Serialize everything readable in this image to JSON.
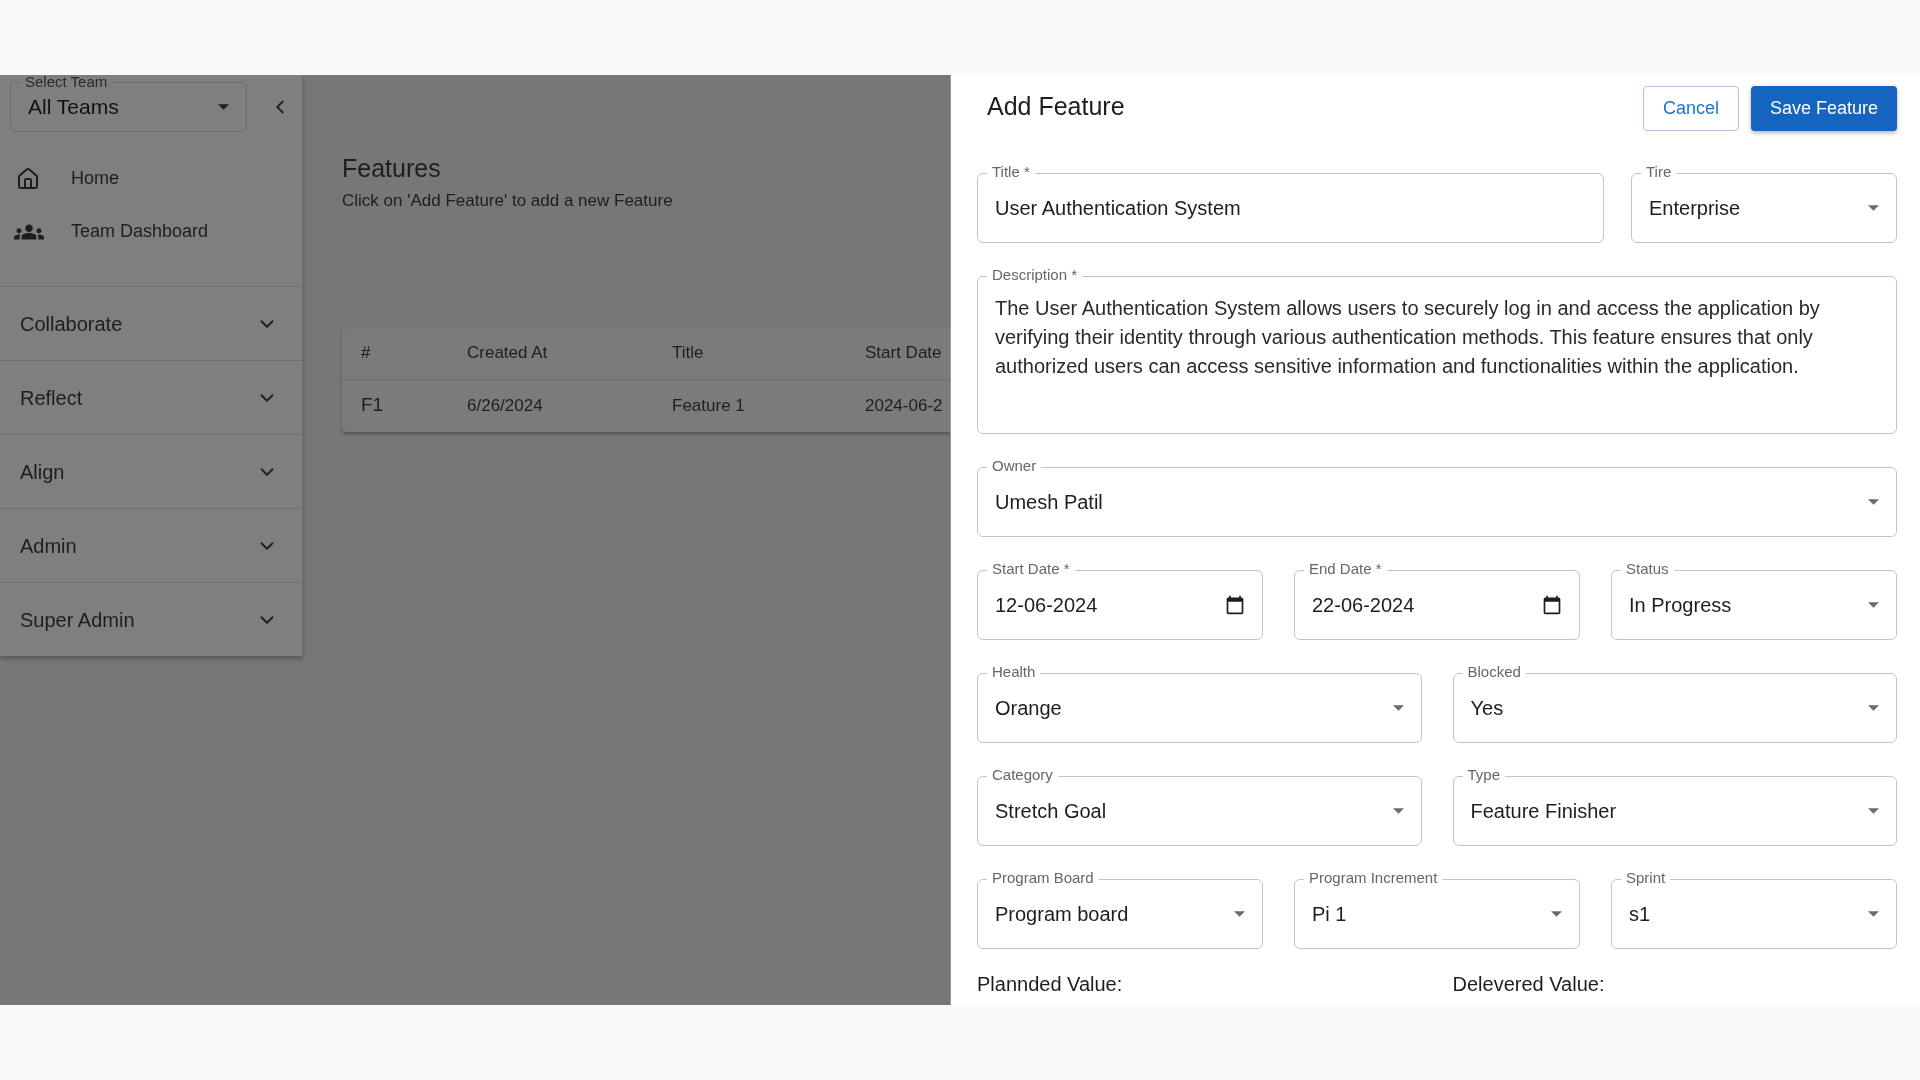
{
  "sidebar": {
    "team_select": {
      "label": "Select Team",
      "value": "All Teams"
    },
    "nav": [
      {
        "label": "Home",
        "kind": "home"
      },
      {
        "label": "Team Dashboard",
        "kind": "team"
      }
    ],
    "sections": [
      {
        "label": "Collaborate",
        "expanded": false
      },
      {
        "label": "Reflect",
        "expanded": false
      },
      {
        "label": "Align",
        "expanded": false
      },
      {
        "label": "Admin",
        "expanded": false
      },
      {
        "label": "Super Admin",
        "expanded": false
      }
    ]
  },
  "main": {
    "title": "Features",
    "subtitle": "Click on 'Add Feature' to add a new Feature",
    "table": {
      "columns": [
        "#",
        "Created At",
        "Title",
        "Start Date"
      ],
      "rows": [
        [
          "F1",
          "6/26/2024",
          "Feature 1",
          "2024-06-2"
        ]
      ]
    }
  },
  "drawer": {
    "title": "Add Feature",
    "buttons": [
      {
        "label": "Cancel",
        "kind": "outlined"
      },
      {
        "label": "Save Feature",
        "kind": "contained"
      }
    ],
    "rows": [
      {
        "kind": "wide",
        "fields": [
          {
            "kind": "text",
            "label": "Title *",
            "value": "User Authentication System"
          },
          {
            "kind": "select",
            "label": "Tire",
            "value": "Enterprise"
          }
        ]
      },
      {
        "kind": "full",
        "fields": [
          {
            "kind": "textarea",
            "label": "Description *",
            "value": "The User Authentication System allows users to securely log in and access the application by verifying their identity through various authentication methods. This feature ensures that only authorized users can access sensitive information and functionalities within the application."
          }
        ]
      },
      {
        "kind": "full",
        "fields": [
          {
            "kind": "select",
            "label": "Owner",
            "value": "Umesh Patil"
          }
        ]
      },
      {
        "kind": "thirds",
        "fields": [
          {
            "kind": "date",
            "label": "Start Date *",
            "value": "12-06-2024"
          },
          {
            "kind": "date",
            "label": "End Date *",
            "value": "22-06-2024"
          },
          {
            "kind": "select",
            "label": "Status",
            "value": "In Progress"
          }
        ]
      },
      {
        "kind": "halves",
        "fields": [
          {
            "kind": "select",
            "label": "Health",
            "value": "Orange"
          },
          {
            "kind": "select",
            "label": "Blocked",
            "value": "Yes"
          }
        ]
      },
      {
        "kind": "halves",
        "fields": [
          {
            "kind": "select",
            "label": "Category",
            "value": "Stretch Goal"
          },
          {
            "kind": "select",
            "label": "Type",
            "value": "Feature Finisher"
          }
        ]
      },
      {
        "kind": "thirds",
        "fields": [
          {
            "kind": "select",
            "label": "Program Board",
            "value": "Program board"
          },
          {
            "kind": "select",
            "label": "Program Increment",
            "value": "Pi 1"
          },
          {
            "kind": "select",
            "label": "Sprint",
            "value": "s1"
          }
        ]
      }
    ],
    "values": [
      {
        "label": "Plannded Value:"
      },
      {
        "label": "Delevered Value:"
      }
    ]
  }
}
